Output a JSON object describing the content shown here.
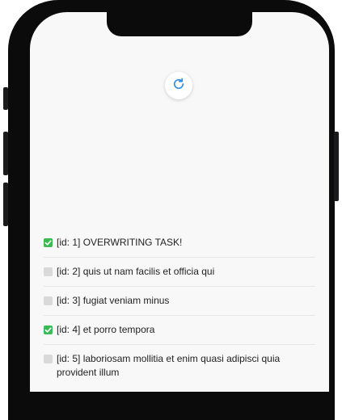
{
  "refresh": {
    "icon": "refresh-icon"
  },
  "todos": [
    {
      "id_label": "[id: 1]",
      "title": "OVERWRITING TASK!",
      "completed": true
    },
    {
      "id_label": "[id: 2]",
      "title": "quis ut nam facilis et officia qui",
      "completed": false
    },
    {
      "id_label": "[id: 3]",
      "title": "fugiat veniam minus",
      "completed": false
    },
    {
      "id_label": "[id: 4]",
      "title": "et porro tempora",
      "completed": true
    },
    {
      "id_label": "[id: 5]",
      "title": "laboriosam mollitia et enim quasi adipisci quia provident illum",
      "completed": false
    }
  ],
  "colors": {
    "completed": "#3cba54",
    "pending": "#d9d9d9",
    "refresh_accent": "#2f8fdd"
  }
}
